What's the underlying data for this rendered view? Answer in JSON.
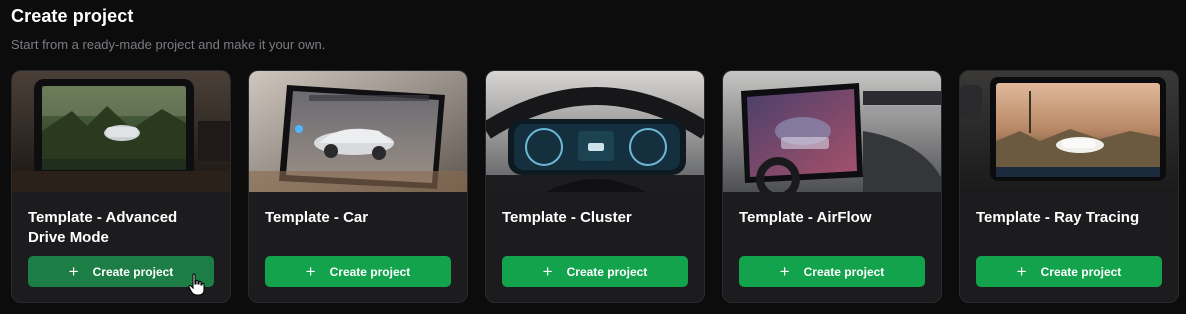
{
  "header": {
    "title": "Create project",
    "subtitle": "Start from a ready-made project and make it your own."
  },
  "cards": [
    {
      "title": "Template - Advanced Drive Mode",
      "button_label": "Create project",
      "plus": "+"
    },
    {
      "title": "Template - Car",
      "button_label": "Create project",
      "plus": "+"
    },
    {
      "title": "Template - Cluster",
      "button_label": "Create project",
      "plus": "+"
    },
    {
      "title": "Template - AirFlow",
      "button_label": "Create project",
      "plus": "+"
    },
    {
      "title": "Template - Ray Tracing",
      "button_label": "Create project",
      "plus": "+"
    }
  ],
  "colors": {
    "background": "#0c0c0d",
    "card": "#1c1c1f",
    "button": "#12a34c",
    "button_hover": "#1c7e44",
    "subtitle": "#7c7c82"
  },
  "icons": {
    "plus": "plus-icon",
    "cursor": "hand-pointer-cursor-icon"
  }
}
